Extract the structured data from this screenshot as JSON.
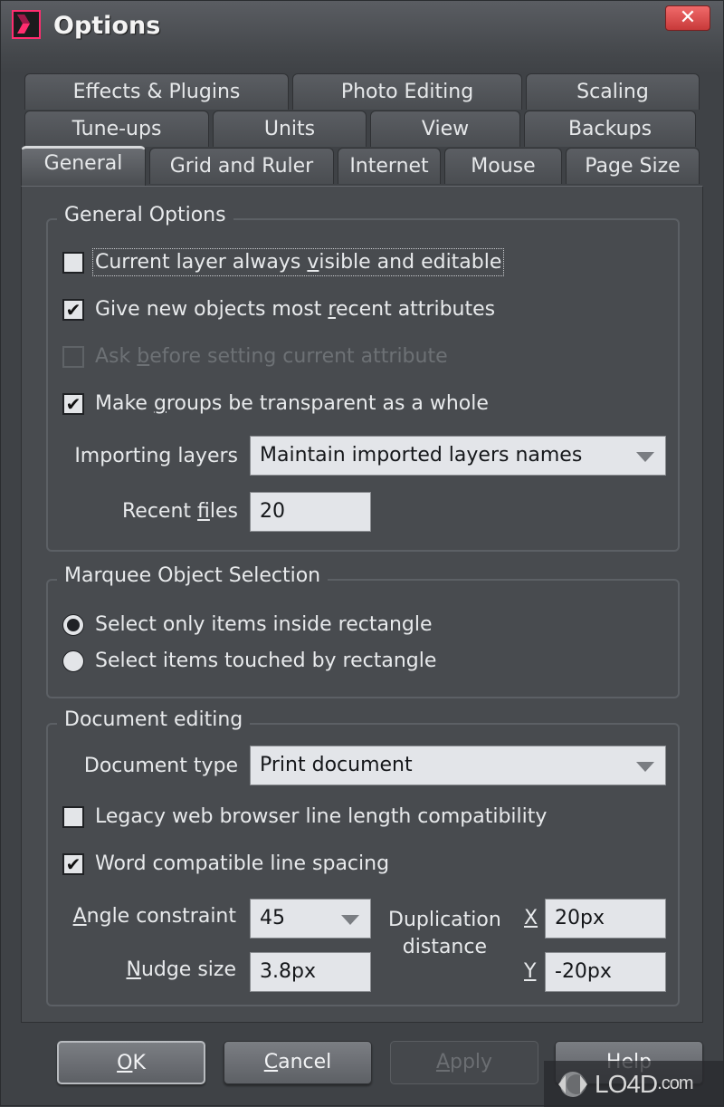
{
  "window": {
    "title": "Options",
    "close_glyph": "✕"
  },
  "tabs": {
    "row1": [
      {
        "label": "Effects & Plugins"
      },
      {
        "label": "Photo Editing"
      },
      {
        "label": "Scaling"
      }
    ],
    "row2": [
      {
        "label": "Tune-ups"
      },
      {
        "label": "Units"
      },
      {
        "label": "View"
      },
      {
        "label": "Backups"
      }
    ],
    "row3": [
      {
        "label": "General",
        "active": true
      },
      {
        "label": "Grid and Ruler"
      },
      {
        "label": "Internet"
      },
      {
        "label": "Mouse"
      },
      {
        "label": "Page Size"
      }
    ]
  },
  "general_options": {
    "title": "General Options",
    "checkboxes": [
      {
        "pre": "Current layer always ",
        "ul": "v",
        "post": "isible and editable",
        "checked": false,
        "disabled": false,
        "focused": true
      },
      {
        "pre": "Give new objects most ",
        "ul": "r",
        "post": "ecent attributes",
        "checked": true,
        "disabled": false
      },
      {
        "pre": "Ask ",
        "ul": "b",
        "post": "efore setting current attribute",
        "checked": false,
        "disabled": true
      },
      {
        "pre": "Make ",
        "ul": "g",
        "post": "roups be transparent as a whole",
        "checked": true,
        "disabled": false
      }
    ],
    "importing_layers": {
      "label": "Importing layers",
      "value": "Maintain imported layers names"
    },
    "recent_files": {
      "label_pre": "Recent ",
      "label_ul": "f",
      "label_post": "iles",
      "value": "20"
    }
  },
  "marquee": {
    "title": "Marquee Object Selection",
    "options": [
      {
        "label": "Select only items inside rectangle",
        "selected": true
      },
      {
        "label": "Select items touched by rectangle",
        "selected": false
      }
    ]
  },
  "document_editing": {
    "title": "Document editing",
    "document_type": {
      "label": "Document type",
      "value": "Print document"
    },
    "checkboxes": [
      {
        "label": "Legacy web browser line length compatibility",
        "checked": false
      },
      {
        "label": "Word compatible line spacing",
        "checked": true
      }
    ],
    "angle_constraint": {
      "label_ul": "A",
      "label_post": "ngle constraint",
      "value": "45"
    },
    "nudge_size": {
      "label_ul": "N",
      "label_post": "udge size",
      "value": "3.8px"
    },
    "duplication": {
      "label_line1": "Duplication",
      "label_line2": "distance",
      "x_label": "X",
      "x_value": "20px",
      "y_label": "Y",
      "y_value": "-20px"
    }
  },
  "buttons": {
    "ok": {
      "ul": "O",
      "post": "K"
    },
    "cancel": {
      "ul": "C",
      "post": "ancel"
    },
    "apply": {
      "ul": "A",
      "post": "pply"
    },
    "help": {
      "label": "Help"
    }
  },
  "watermark": {
    "text": "LO4D",
    "suffix": ".com"
  }
}
